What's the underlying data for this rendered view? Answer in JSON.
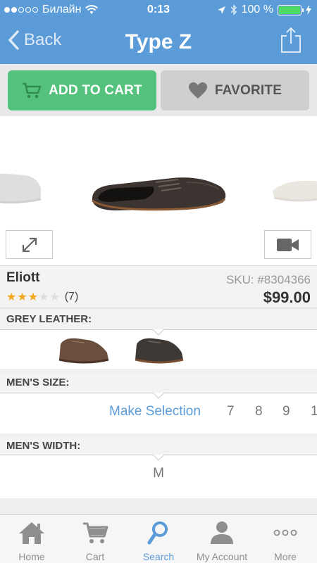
{
  "status_bar": {
    "carrier": "Билайн",
    "time": "0:13",
    "battery_percent": "100 %",
    "battery_level": 1.0
  },
  "nav": {
    "back_label": "Back",
    "title": "Type Z",
    "share_icon": "share-icon"
  },
  "actions": {
    "add_to_cart_label": "ADD TO CART",
    "favorite_label": "FAVORITE"
  },
  "product": {
    "name": "Eliott",
    "rating": 3,
    "rating_max": 5,
    "review_count": "(7)",
    "sku": "SKU: #8304366",
    "price": "$99.00"
  },
  "color_option": {
    "label": "GREY LEATHER:"
  },
  "size_option": {
    "label": "MEN'S SIZE:",
    "make_selection": "Make Selection",
    "sizes": [
      "7",
      "8",
      "9",
      "1"
    ]
  },
  "width_option": {
    "label": "MEN'S WIDTH:",
    "value": "M"
  },
  "tabbar": {
    "items": [
      {
        "label": "Home",
        "icon": "home-icon"
      },
      {
        "label": "Cart",
        "icon": "cart-icon"
      },
      {
        "label": "Search",
        "icon": "search-icon"
      },
      {
        "label": "My Account",
        "icon": "account-icon"
      },
      {
        "label": "More",
        "icon": "more-icon"
      }
    ],
    "active": "Search"
  },
  "colors": {
    "nav_blue": "#5a9bd8",
    "cart_green": "#54c27c",
    "favorite_grey": "#cfcfcf",
    "star_gold": "#f0a81e",
    "battery_green": "#4cd964"
  }
}
